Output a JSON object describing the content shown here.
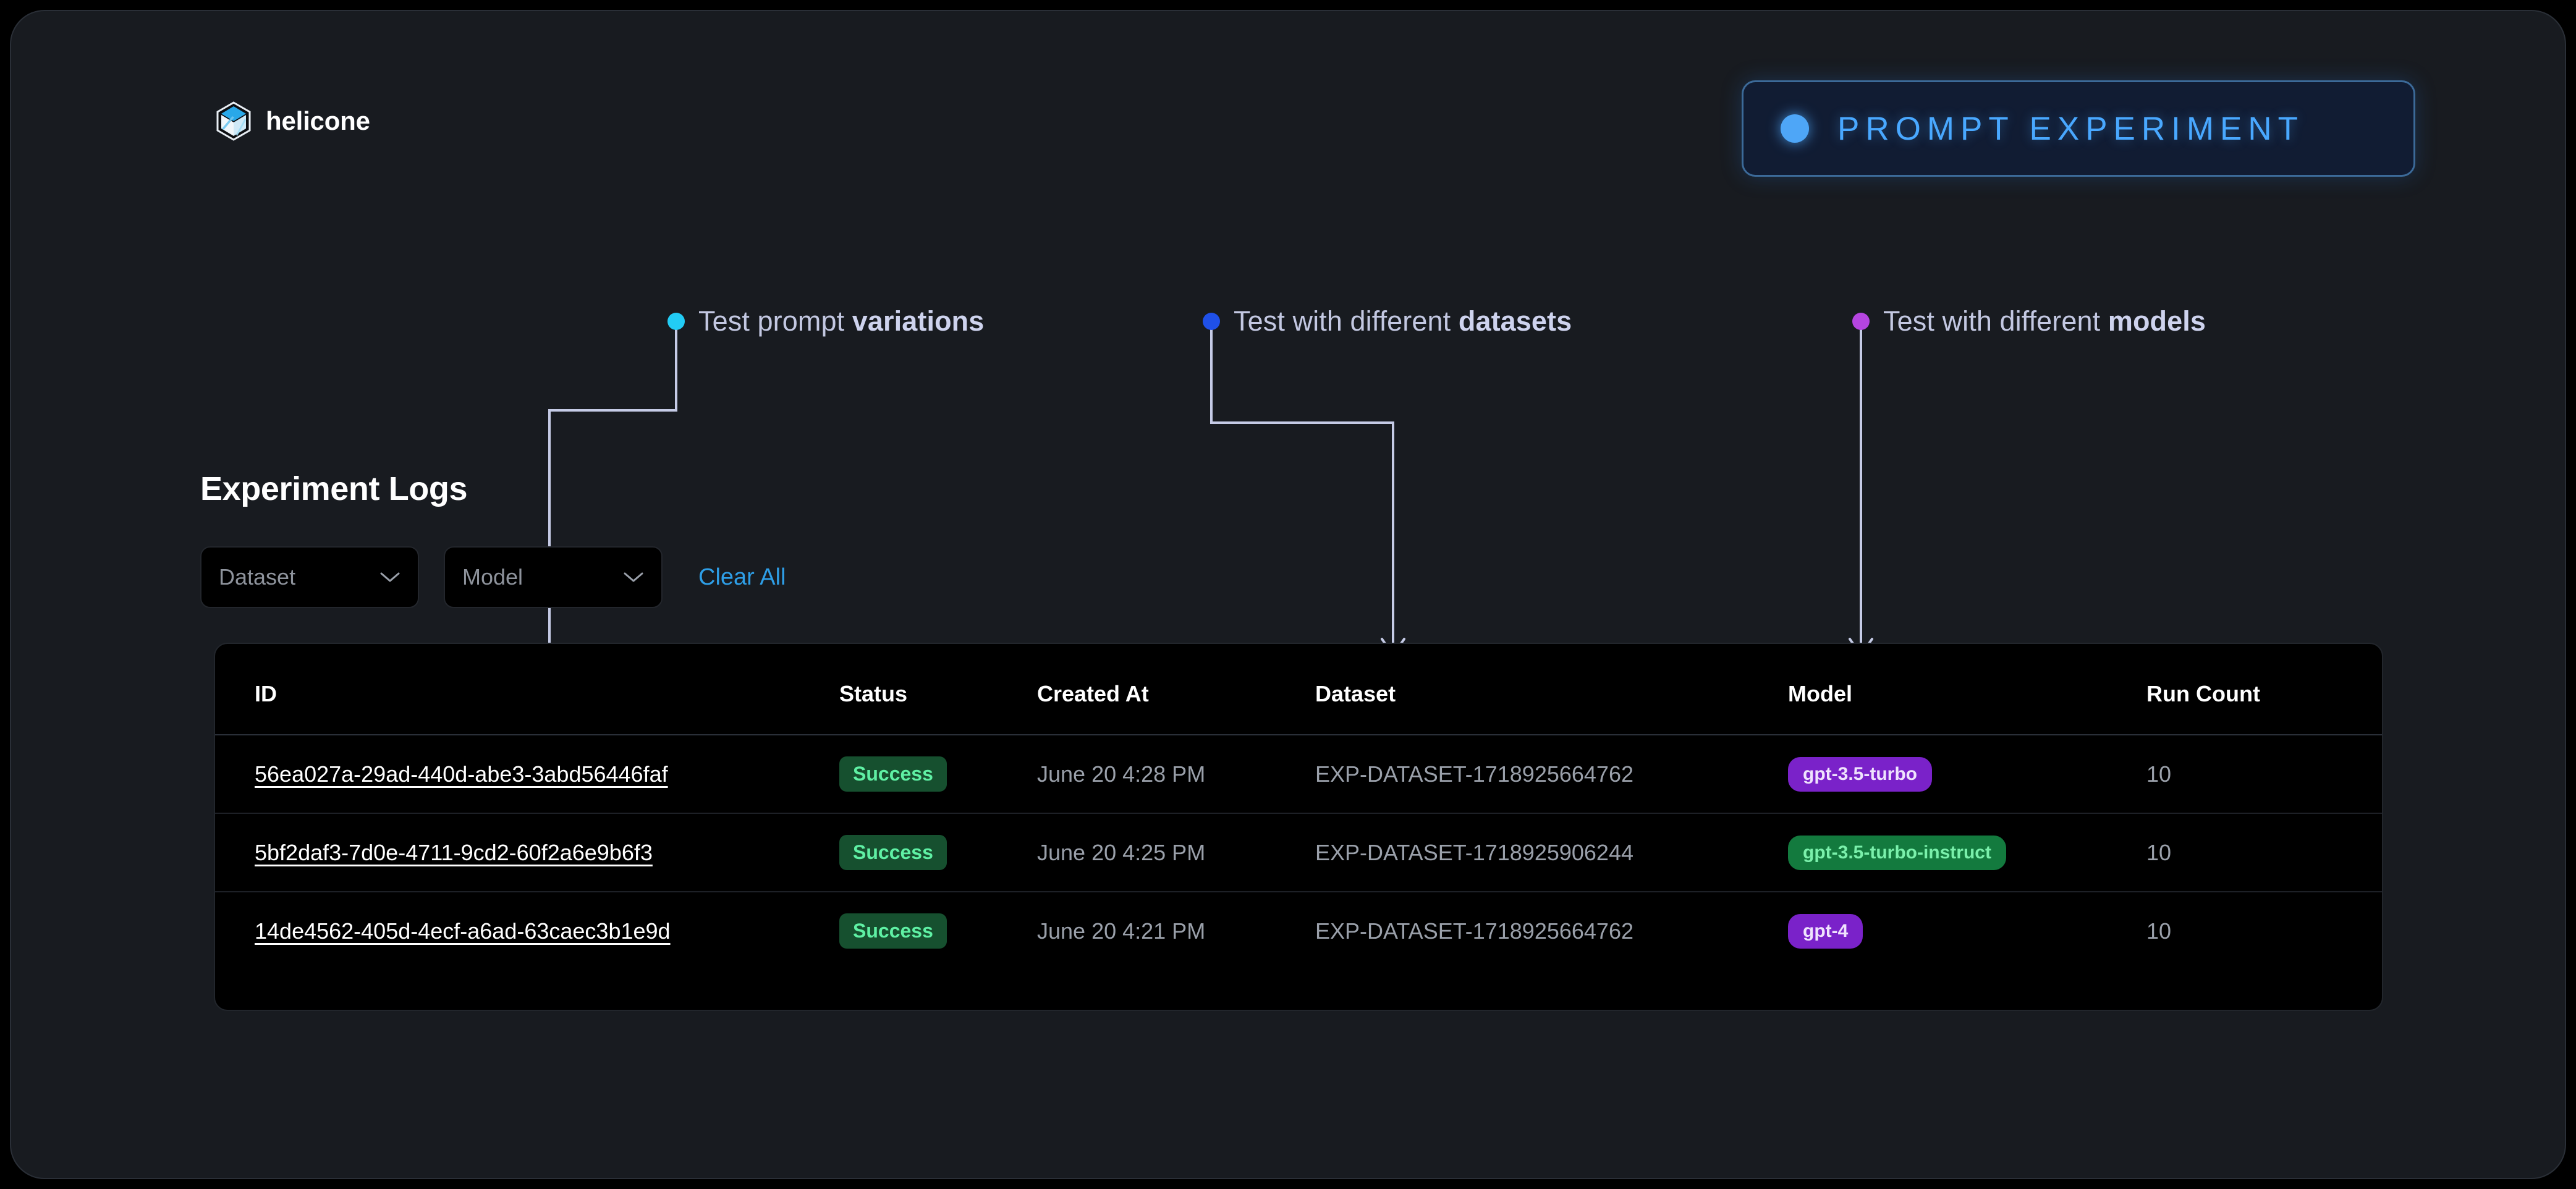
{
  "header": {
    "brand_name": "helicone",
    "logo_icon": "helicone-cube-icon",
    "badge": {
      "label": "PROMPT EXPERIMENT",
      "dot_icon": "status-dot-icon",
      "accent_color": "#49a8ff",
      "border_color": "#3c6a99",
      "background_color": "#111c33"
    }
  },
  "callouts": [
    {
      "prefix": "Test prompt ",
      "emphasis": "variations",
      "dot_color": "#22ccf5",
      "dot_icon": "callout-dot-icon"
    },
    {
      "prefix": "Test with different ",
      "emphasis": "datasets",
      "dot_color": "#1f50e8",
      "dot_icon": "callout-dot-icon"
    },
    {
      "prefix": "Test with different ",
      "emphasis": "models",
      "dot_color": "#b545e0",
      "dot_icon": "callout-dot-icon"
    }
  ],
  "main": {
    "section_title": "Experiment Logs",
    "filters": {
      "dataset_placeholder": "Dataset",
      "model_placeholder": "Model",
      "clear_all_label": "Clear All",
      "clear_all_color": "#2e9fe8",
      "chevron_icon": "chevron-down-icon"
    },
    "table": {
      "columns": [
        "ID",
        "Status",
        "Created At",
        "Dataset",
        "Model",
        "Run Count"
      ],
      "rows": [
        {
          "id": "56ea027a-29ad-440d-abe3-3abd56446faf",
          "status": "Success",
          "created_at": "June 20 4:28 PM",
          "dataset": "EXP-DATASET-1718925664762",
          "model": "gpt-3.5-turbo",
          "model_style": "purple",
          "run_count": "10"
        },
        {
          "id": "5bf2daf3-7d0e-4711-9cd2-60f2a6e9b6f3",
          "status": "Success",
          "created_at": "June 20 4:25 PM",
          "dataset": "EXP-DATASET-1718925906244",
          "model": "gpt-3.5-turbo-instruct",
          "model_style": "green",
          "run_count": "10"
        },
        {
          "id": "14de4562-405d-4ecf-a6ad-63caec3b1e9d",
          "status": "Success",
          "created_at": "June 20 4:21 PM",
          "dataset": "EXP-DATASET-1718925664762",
          "model": "gpt-4",
          "model_style": "purple",
          "run_count": "10"
        }
      ],
      "status_colors": {
        "success_bg": "#16502f",
        "success_text": "#5ff0a4"
      },
      "model_colors": {
        "purple": "#7a22c9",
        "green": "#137a3e"
      }
    }
  }
}
